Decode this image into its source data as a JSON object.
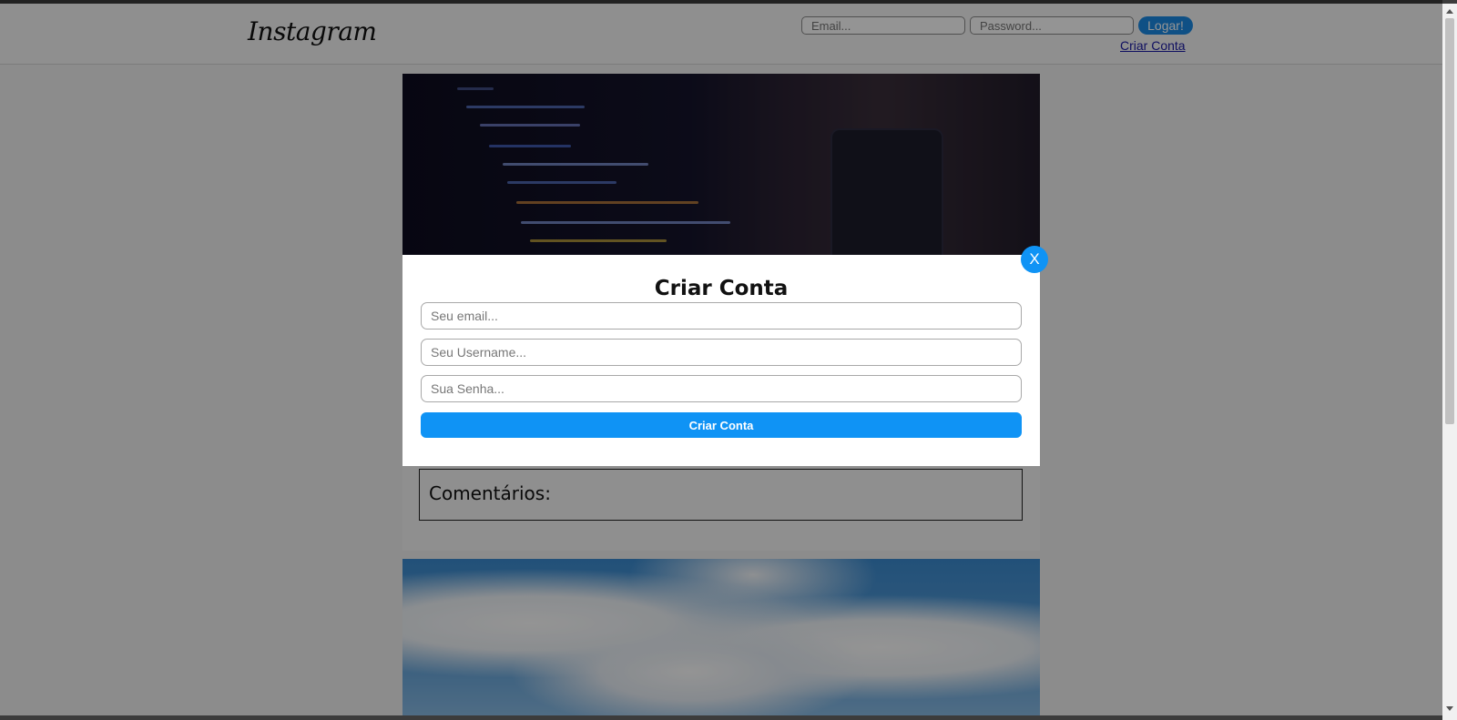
{
  "header": {
    "logo": "Instagram",
    "email_placeholder": "Email...",
    "password_placeholder": "Password...",
    "login_label": "Logar!",
    "create_account_link": "Criar Conta"
  },
  "feed": {
    "comments_title": "Comentários:"
  },
  "modal": {
    "title": "Criar Conta",
    "email_placeholder": "Seu email...",
    "username_placeholder": "Seu Username...",
    "password_placeholder": "Sua Senha...",
    "submit_label": "Criar Conta",
    "close_label": "X"
  },
  "colors": {
    "accent": "#0f93f5",
    "link": "#1a1aa6",
    "overlay": "rgba(0,0,0,0.42)"
  }
}
